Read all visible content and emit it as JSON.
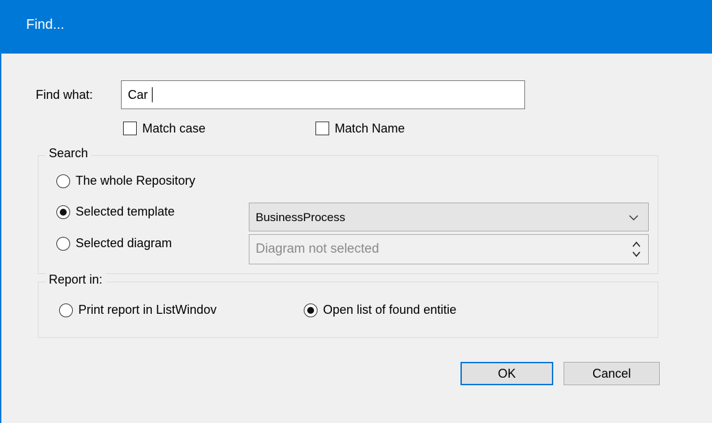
{
  "window": {
    "title": "Find..."
  },
  "find": {
    "label": "Find what:",
    "value": "Car"
  },
  "options": {
    "match_case": "Match case",
    "match_name": "Match Name"
  },
  "search": {
    "legend": "Search",
    "whole_repository": "The whole Repository",
    "selected_template": "Selected template",
    "selected_diagram": "Selected diagram",
    "template_value": "BusinessProcess",
    "diagram_placeholder": "Diagram not selected",
    "selected_option": "Selected template"
  },
  "report": {
    "legend": "Report in:",
    "print_report": "Print report in ListWindov",
    "open_list": "Open list of found entitie",
    "selected_option": "Open list of found entitie"
  },
  "buttons": {
    "ok": "OK",
    "cancel": "Cancel"
  },
  "colors": {
    "titlebar": "#0078d7",
    "background": "#f0f0f0"
  }
}
